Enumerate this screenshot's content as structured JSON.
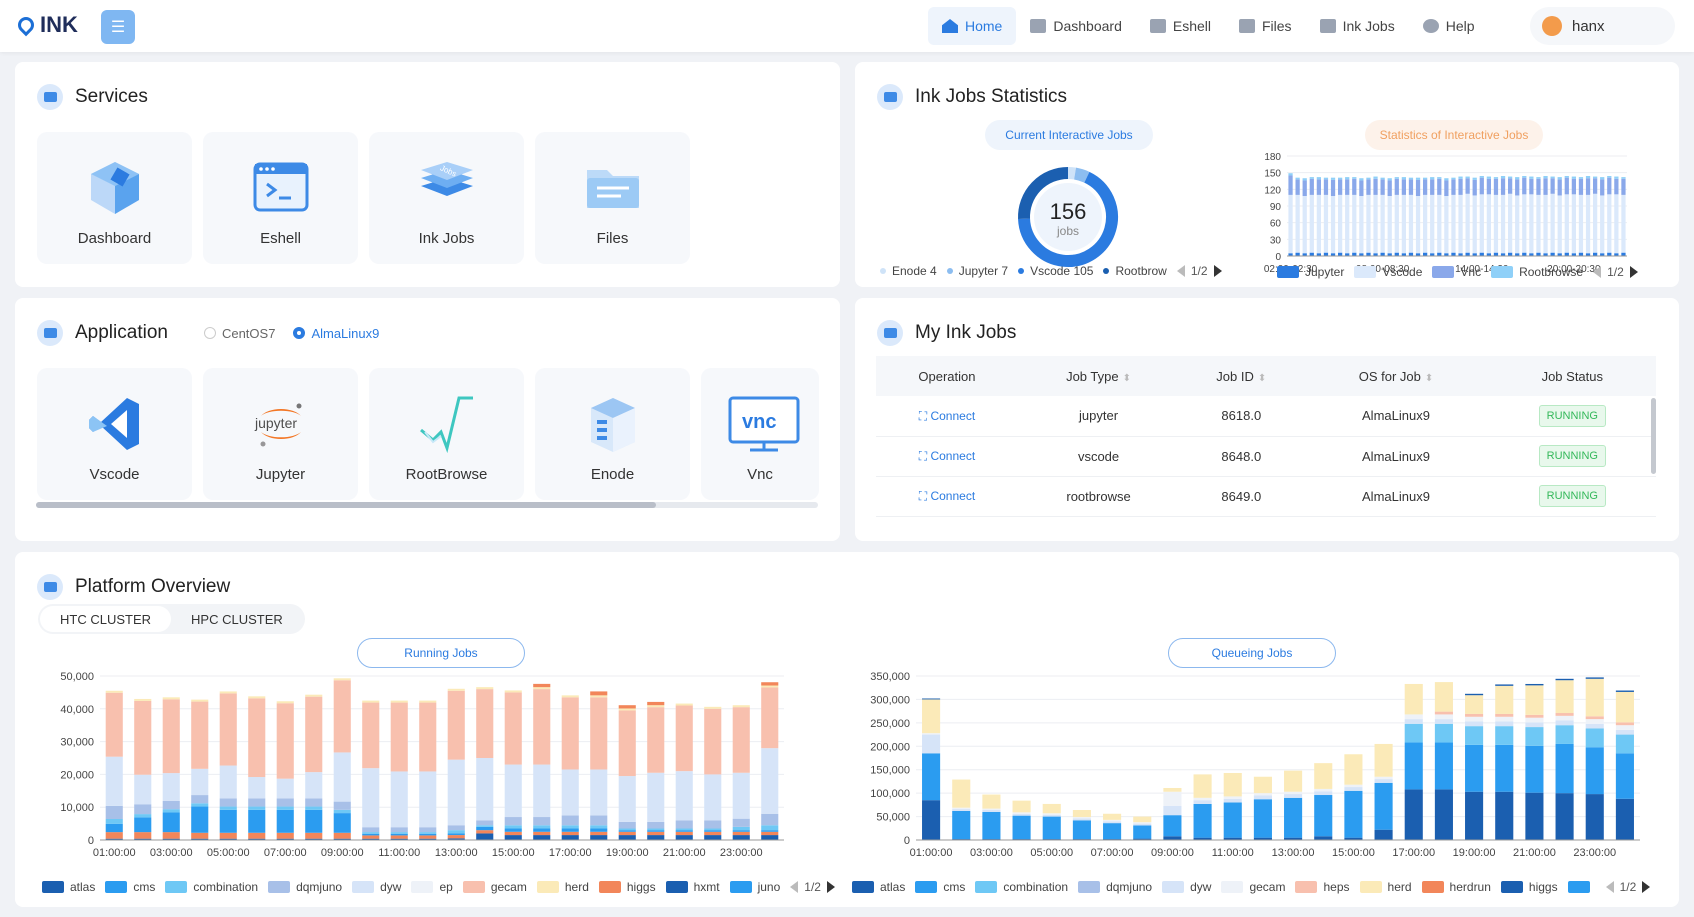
{
  "app": {
    "logo": "INK"
  },
  "nav": [
    {
      "label": "Home",
      "icon": "home-icon",
      "active": true
    },
    {
      "label": "Dashboard",
      "icon": "dashboard-icon"
    },
    {
      "label": "Eshell",
      "icon": "terminal-icon"
    },
    {
      "label": "Files",
      "icon": "folder-icon"
    },
    {
      "label": "Ink Jobs",
      "icon": "layers-icon"
    },
    {
      "label": "Help",
      "icon": "help-icon"
    }
  ],
  "user": {
    "name": "hanx"
  },
  "services": {
    "title": "Services",
    "tiles": [
      {
        "label": "Dashboard"
      },
      {
        "label": "Eshell"
      },
      {
        "label": "Ink Jobs"
      },
      {
        "label": "Files"
      }
    ]
  },
  "application": {
    "title": "Application",
    "os_options": [
      {
        "label": "CentOS7",
        "selected": false
      },
      {
        "label": "AlmaLinux9",
        "selected": true
      }
    ],
    "tiles": [
      {
        "label": "Vscode"
      },
      {
        "label": "Jupyter"
      },
      {
        "label": "RootBrowse"
      },
      {
        "label": "Enode"
      },
      {
        "label": "Vnc"
      }
    ]
  },
  "stats": {
    "title": "Ink Jobs Statistics",
    "current_label": "Current Interactive Jobs",
    "history_label": "Statistics of Interactive Jobs",
    "donut": {
      "total": "156",
      "unit": "jobs"
    },
    "donut_legend": [
      {
        "name": "Enode 4",
        "color": "#cfe3f8"
      },
      {
        "name": "Jupyter 7",
        "color": "#8cbdf0"
      },
      {
        "name": "Vscode 105",
        "color": "#2b7be0"
      },
      {
        "name": "Rootbrow",
        "color": "#1b5fb0"
      }
    ],
    "donut_pager": "1/2",
    "history_legend": [
      {
        "name": "Jupyter",
        "color": "#2b7be0"
      },
      {
        "name": "Vscode",
        "color": "#dbe9fb"
      },
      {
        "name": "Vnc",
        "color": "#8aa8ea"
      },
      {
        "name": "Rootbrowse",
        "color": "#8fd0f8"
      }
    ],
    "history_pager": "1/2"
  },
  "my_jobs": {
    "title": "My Ink Jobs",
    "columns": [
      "Operation",
      "Job Type",
      "Job ID",
      "OS for Job",
      "Job Status"
    ],
    "rows": [
      {
        "op": "Connect",
        "type": "jupyter",
        "id": "8618.0",
        "os": "AlmaLinux9",
        "status": "RUNNING"
      },
      {
        "op": "Connect",
        "type": "vscode",
        "id": "8648.0",
        "os": "AlmaLinux9",
        "status": "RUNNING"
      },
      {
        "op": "Connect",
        "type": "rootbrowse",
        "id": "8649.0",
        "os": "AlmaLinux9",
        "status": "RUNNING"
      }
    ]
  },
  "platform": {
    "title": "Platform Overview",
    "tabs": [
      "HTC CLUSTER",
      "HPC CLUSTER"
    ],
    "running_label": "Running Jobs",
    "queueing_label": "Queueing Jobs",
    "running_legend": [
      {
        "name": "atlas",
        "color": "#1b5fb0"
      },
      {
        "name": "cms",
        "color": "#2b9cf0"
      },
      {
        "name": "combination",
        "color": "#6ec8f5"
      },
      {
        "name": "dqmjuno",
        "color": "#a8c0e8"
      },
      {
        "name": "dyw",
        "color": "#d6e4f8"
      },
      {
        "name": "ep",
        "color": "#eef2f8"
      },
      {
        "name": "gecam",
        "color": "#f8c0ae"
      },
      {
        "name": "herd",
        "color": "#fbeab8"
      },
      {
        "name": "higgs",
        "color": "#f2865a"
      },
      {
        "name": "hxmt",
        "color": "#1b5fb0"
      },
      {
        "name": "juno",
        "color": "#2b9cf0"
      }
    ],
    "running_pager": "1/2",
    "queueing_legend": [
      {
        "name": "atlas",
        "color": "#1b5fb0"
      },
      {
        "name": "cms",
        "color": "#2b9cf0"
      },
      {
        "name": "combination",
        "color": "#6ec8f5"
      },
      {
        "name": "dqmjuno",
        "color": "#a8c0e8"
      },
      {
        "name": "dyw",
        "color": "#d6e4f8"
      },
      {
        "name": "gecam",
        "color": "#eef2f8"
      },
      {
        "name": "heps",
        "color": "#f8c0ae"
      },
      {
        "name": "herd",
        "color": "#fbeab8"
      },
      {
        "name": "herdrun",
        "color": "#f2865a"
      },
      {
        "name": "higgs",
        "color": "#1b5fb0"
      },
      {
        "name": "",
        "color": "#2b9cf0"
      }
    ],
    "queueing_pager": "1/2"
  },
  "chart_data": [
    {
      "type": "bar",
      "stacked": true,
      "id": "interactive-history",
      "x_ticks": [
        "02:00-02:30",
        "08:00-08:30",
        "14:00-14:30",
        "20:00-20:30"
      ],
      "ylim": [
        0,
        180
      ],
      "y_ticks": [
        0,
        30,
        60,
        90,
        120,
        150,
        180
      ],
      "bar_count": 48,
      "series": [
        {
          "name": "Jupyter",
          "color": "#2b7be0",
          "values": [
            5,
            6,
            5,
            6,
            5,
            6,
            5,
            6,
            5,
            6,
            5,
            6,
            5,
            6,
            5,
            6,
            5,
            6,
            5,
            6,
            5,
            6,
            5,
            6,
            5,
            6,
            5,
            6,
            5,
            6,
            5,
            6,
            5,
            6,
            5,
            6,
            5,
            6,
            5,
            6,
            5,
            6,
            5,
            6,
            5,
            6,
            5,
            6
          ]
        },
        {
          "name": "Vscode",
          "color": "#dbe9fb",
          "values": [
            105,
            104,
            103,
            104,
            105,
            104,
            103,
            104,
            105,
            104,
            103,
            104,
            105,
            104,
            103,
            104,
            105,
            104,
            103,
            104,
            105,
            104,
            103,
            104,
            105,
            106,
            104,
            105,
            106,
            104,
            105,
            106,
            104,
            105,
            106,
            104,
            105,
            106,
            104,
            105,
            106,
            104,
            105,
            106,
            104,
            105,
            106,
            104
          ]
        },
        {
          "name": "Vnc",
          "color": "#8aa8ea",
          "values": [
            35,
            28,
            28,
            29,
            28,
            28,
            29,
            28,
            28,
            29,
            28,
            28,
            29,
            28,
            28,
            29,
            28,
            28,
            29,
            28,
            28,
            29,
            28,
            28,
            29,
            28,
            28,
            30,
            28,
            29,
            30,
            28,
            29,
            30,
            28,
            29,
            30,
            28,
            29,
            30,
            28,
            29,
            30,
            28,
            29,
            30,
            28,
            29
          ]
        },
        {
          "name": "Rootbrowse",
          "color": "#8fd0f8",
          "values": [
            4,
            3,
            4,
            3,
            4,
            3,
            4,
            3,
            4,
            3,
            4,
            3,
            4,
            3,
            4,
            3,
            4,
            3,
            4,
            3,
            4,
            3,
            4,
            3,
            4,
            3,
            4,
            3,
            4,
            3,
            4,
            3,
            4,
            3,
            4,
            3,
            4,
            3,
            4,
            3,
            4,
            3,
            4,
            3,
            4,
            3,
            4,
            3
          ]
        }
      ]
    },
    {
      "type": "bar",
      "stacked": true,
      "id": "running-jobs",
      "title": "Running Jobs",
      "categories": [
        "01:00:00",
        "02:00:00",
        "03:00:00",
        "04:00:00",
        "05:00:00",
        "06:00:00",
        "07:00:00",
        "08:00:00",
        "09:00:00",
        "10:00:00",
        "11:00:00",
        "12:00:00",
        "13:00:00",
        "14:00:00",
        "15:00:00",
        "16:00:00",
        "17:00:00",
        "18:00:00",
        "19:00:00",
        "20:00:00",
        "21:00:00",
        "22:00:00",
        "23:00:00",
        "24:00:00"
      ],
      "x_ticks": [
        "01:00:00",
        "03:00:00",
        "05:00:00",
        "07:00:00",
        "09:00:00",
        "11:00:00",
        "13:00:00",
        "15:00:00",
        "17:00:00",
        "19:00:00",
        "21:00:00",
        "23:00:00"
      ],
      "ylim": [
        0,
        50000
      ],
      "y_ticks": [
        0,
        10000,
        20000,
        30000,
        40000,
        50000
      ],
      "series": [
        {
          "name": "atlas",
          "color": "#1b5fb0",
          "values": [
            400,
            400,
            400,
            400,
            400,
            400,
            400,
            400,
            400,
            400,
            400,
            400,
            500,
            2000,
            1500,
            1500,
            1500,
            1500,
            1500,
            1500,
            1500,
            1500,
            1500,
            1500
          ]
        },
        {
          "name": "higgs",
          "color": "#f2865a",
          "values": [
            2000,
            2000,
            2000,
            1800,
            1800,
            1800,
            1800,
            1800,
            1800,
            1000,
            1000,
            1000,
            1000,
            1000,
            1000,
            1000,
            1000,
            1000,
            1000,
            1000,
            1000,
            1000,
            1000,
            1000
          ]
        },
        {
          "name": "cms",
          "color": "#2b9cf0",
          "values": [
            2500,
            4500,
            6000,
            8000,
            7000,
            7000,
            7000,
            7000,
            6000,
            500,
            500,
            500,
            500,
            1000,
            1000,
            1000,
            1000,
            1000,
            500,
            500,
            500,
            500,
            500,
            500
          ]
        },
        {
          "name": "combination",
          "color": "#6ec8f5",
          "values": [
            1500,
            1000,
            1000,
            1000,
            1000,
            1000,
            1000,
            1000,
            1000,
            500,
            500,
            500,
            1000,
            500,
            1000,
            1000,
            1000,
            1000,
            500,
            500,
            500,
            500,
            1000,
            1500
          ]
        },
        {
          "name": "dqmjuno",
          "color": "#a8c0e8",
          "values": [
            4000,
            3000,
            2500,
            2500,
            2500,
            2500,
            2500,
            2500,
            2500,
            1500,
            1500,
            1500,
            1500,
            1500,
            2500,
            2500,
            3000,
            3000,
            2000,
            2000,
            2500,
            2500,
            2500,
            3500
          ]
        },
        {
          "name": "dyw",
          "color": "#d6e4f8",
          "values": [
            15000,
            9000,
            8500,
            8000,
            10000,
            6500,
            6000,
            8000,
            15000,
            18000,
            17000,
            17000,
            20000,
            19000,
            16000,
            16000,
            14000,
            14000,
            14000,
            15000,
            15000,
            14000,
            14000,
            20000
          ]
        },
        {
          "name": "gecam",
          "color": "#f8c0ae",
          "values": [
            19500,
            22500,
            22500,
            20500,
            22000,
            24000,
            23000,
            23000,
            22000,
            20000,
            21000,
            21000,
            21000,
            21000,
            22000,
            23000,
            22000,
            22000,
            20000,
            20000,
            20000,
            20000,
            20000,
            18500
          ]
        },
        {
          "name": "herd",
          "color": "#fbeab8",
          "values": [
            600,
            600,
            600,
            600,
            600,
            600,
            600,
            600,
            600,
            600,
            600,
            600,
            600,
            600,
            600,
            600,
            600,
            600,
            600,
            600,
            600,
            600,
            600,
            600
          ]
        },
        {
          "name": "hxmt",
          "color": "#f2865a",
          "values": [
            0,
            0,
            0,
            0,
            0,
            0,
            0,
            0,
            0,
            0,
            0,
            0,
            0,
            0,
            0,
            1000,
            0,
            1200,
            1000,
            1000,
            0,
            0,
            0,
            1000
          ]
        }
      ]
    },
    {
      "type": "bar",
      "stacked": true,
      "id": "queueing-jobs",
      "title": "Queueing Jobs",
      "categories": [
        "01:00:00",
        "02:00:00",
        "03:00:00",
        "04:00:00",
        "05:00:00",
        "06:00:00",
        "07:00:00",
        "08:00:00",
        "09:00:00",
        "10:00:00",
        "11:00:00",
        "12:00:00",
        "13:00:00",
        "14:00:00",
        "15:00:00",
        "16:00:00",
        "17:00:00",
        "18:00:00",
        "19:00:00",
        "20:00:00",
        "21:00:00",
        "22:00:00",
        "23:00:00",
        "24:00:00"
      ],
      "x_ticks": [
        "01:00:00",
        "03:00:00",
        "05:00:00",
        "07:00:00",
        "09:00:00",
        "11:00:00",
        "13:00:00",
        "15:00:00",
        "17:00:00",
        "19:00:00",
        "21:00:00",
        "23:00:00"
      ],
      "ylim": [
        0,
        350000
      ],
      "y_ticks": [
        0,
        50000,
        100000,
        150000,
        200000,
        250000,
        300000,
        350000
      ],
      "series": [
        {
          "name": "atlas",
          "color": "#1b5fb0",
          "values": [
            85000,
            2000,
            2000,
            2000,
            2000,
            2000,
            2000,
            3000,
            8000,
            5000,
            5000,
            5000,
            5000,
            8000,
            5000,
            22000,
            108000,
            108000,
            103000,
            103000,
            101000,
            100000,
            98000,
            88000
          ]
        },
        {
          "name": "cms",
          "color": "#2b9cf0",
          "values": [
            100000,
            60000,
            58000,
            50000,
            48000,
            40000,
            34000,
            28000,
            45000,
            72000,
            75000,
            82000,
            85000,
            88000,
            100000,
            100000,
            100000,
            100000,
            100000,
            100000,
            100000,
            105000,
            100000,
            97000
          ]
        },
        {
          "name": "combination",
          "color": "#6ec8f5",
          "values": [
            0,
            0,
            0,
            0,
            0,
            0,
            0,
            0,
            0,
            0,
            0,
            0,
            0,
            0,
            0,
            0,
            40000,
            40000,
            40000,
            40000,
            40000,
            40000,
            40000,
            40000
          ]
        },
        {
          "name": "dyw",
          "color": "#d6e4f8",
          "values": [
            40000,
            4000,
            4000,
            4000,
            4000,
            4000,
            4000,
            4000,
            20000,
            8000,
            8000,
            8000,
            8000,
            8000,
            8000,
            8000,
            10000,
            10000,
            10000,
            10000,
            10000,
            10000,
            10000,
            10000
          ]
        },
        {
          "name": "gecam",
          "color": "#eef2f8",
          "values": [
            3000,
            3000,
            3000,
            3000,
            3000,
            3000,
            3000,
            3000,
            30000,
            5000,
            5000,
            5000,
            5000,
            5000,
            5000,
            5000,
            10000,
            10000,
            10000,
            10000,
            10000,
            10000,
            10000,
            10000
          ]
        },
        {
          "name": "heps",
          "color": "#f8c0ae",
          "values": [
            0,
            0,
            0,
            0,
            0,
            0,
            0,
            0,
            0,
            0,
            0,
            0,
            0,
            0,
            0,
            0,
            0,
            6000,
            6000,
            6000,
            6000,
            6000,
            6000,
            6000
          ]
        },
        {
          "name": "herd",
          "color": "#fbeab8",
          "values": [
            72000,
            60000,
            30000,
            25000,
            20000,
            15000,
            13000,
            12000,
            8000,
            50000,
            50000,
            35000,
            45000,
            55000,
            65000,
            70000,
            65000,
            63000,
            40000,
            60000,
            63000,
            70000,
            80000,
            65000
          ]
        },
        {
          "name": "higgs",
          "color": "#1b5fb0",
          "values": [
            2000,
            0,
            0,
            0,
            0,
            0,
            0,
            0,
            0,
            0,
            0,
            0,
            0,
            0,
            0,
            0,
            0,
            0,
            3000,
            3000,
            3000,
            3000,
            3000,
            3000
          ]
        }
      ]
    }
  ]
}
